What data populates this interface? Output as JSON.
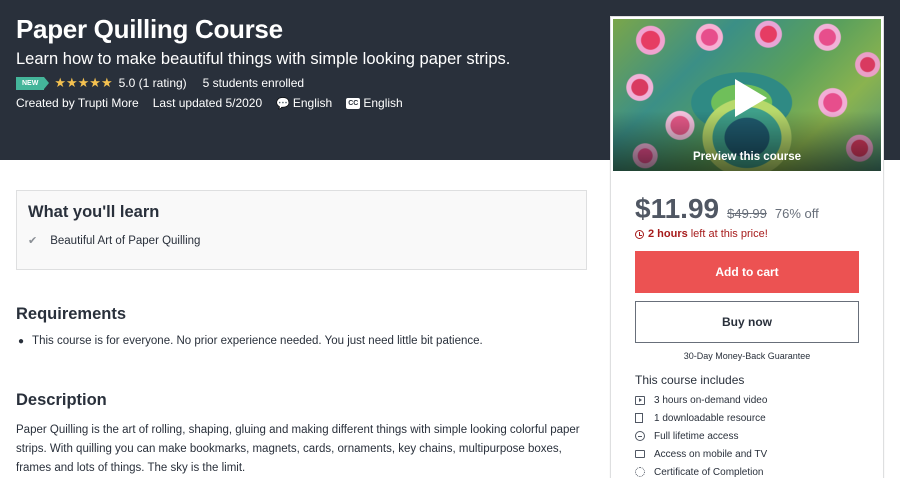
{
  "hero": {
    "title": "Paper Quilling Course",
    "subtitle": "Learn how to make beautiful things with simple looking paper strips.",
    "badge": "NEW",
    "stars": "★★★★★",
    "rating": "5.0 (1 rating)",
    "enrolled": "5 students enrolled",
    "created_by": "Created by Trupti More",
    "last_updated": "Last updated 5/2020",
    "language": "English",
    "captions_icon": "CC",
    "captions": "English",
    "colors": {
      "background": "#29303b",
      "badge": "#44b59a",
      "stars": "#f4c150"
    }
  },
  "sidebar": {
    "preview_label": "Preview this course",
    "price": "$11.99",
    "original_price": "$49.99",
    "discount": "76% off",
    "timer_hours": "2 hours",
    "timer_text": "left at this price!",
    "add_to_cart": "Add to cart",
    "buy_now": "Buy now",
    "guarantee": "30-Day Money-Back Guarantee",
    "includes_title": "This course includes",
    "includes": [
      {
        "icon": "video-icon",
        "label": "3 hours on-demand video"
      },
      {
        "icon": "file-icon",
        "label": "1 downloadable resource"
      },
      {
        "icon": "infinity-icon",
        "label": "Full lifetime access"
      },
      {
        "icon": "mobile-tv-icon",
        "label": "Access on mobile and TV"
      },
      {
        "icon": "certificate-icon",
        "label": "Certificate of Completion"
      }
    ],
    "colors": {
      "cart_button": "#ec5252",
      "timer": "#a61b1b"
    }
  },
  "learn": {
    "title": "What you'll learn",
    "items": [
      "Beautiful Art of Paper Quilling"
    ]
  },
  "requirements": {
    "title": "Requirements",
    "items": [
      "This course is for everyone. No prior experience needed. You just need little bit patience."
    ]
  },
  "description": {
    "title": "Description",
    "text": "Paper Quilling is the art of rolling, shaping, gluing and making different things with simple looking colorful paper strips. With quilling you can make bookmarks, magnets, cards, ornaments, key chains, multipurpose boxes, frames and lots of things. The sky is the limit."
  }
}
